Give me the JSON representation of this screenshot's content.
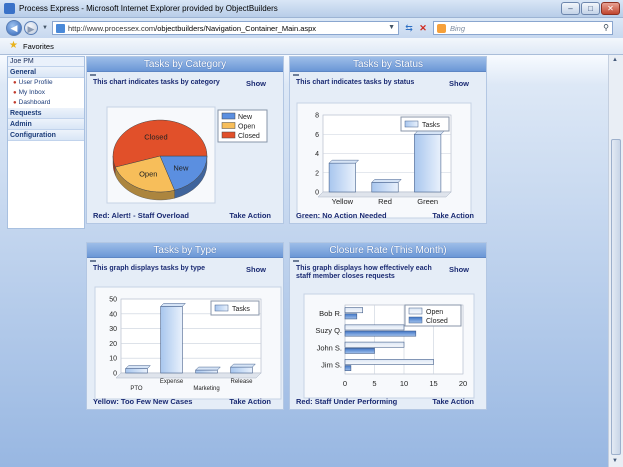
{
  "window": {
    "title": "Process Express - Microsoft Internet Explorer provided by ObjectBuilders"
  },
  "address": {
    "url_host": "http://www.processex.com",
    "url_path": "/objectbuilders/Navigation_Container_Main.aspx",
    "search_placeholder": "Bing"
  },
  "favorites": {
    "label": "Favorites"
  },
  "sidebar": {
    "user": "Joe PM",
    "general": "General",
    "items": [
      "User Profile",
      "My Inbox",
      "Dashboard"
    ],
    "requests": "Requests",
    "admin": "Admin",
    "configuration": "Configuration"
  },
  "panels": {
    "category": {
      "title": "Tasks by Category",
      "desc": "This chart indicates tasks by category",
      "show": "Show",
      "status": "Red: Alert! - Staff Overload",
      "action": "Take Action"
    },
    "status": {
      "title": "Tasks by Status",
      "desc": "This chart indicates tasks by status",
      "show": "Show",
      "status": "Green: No Action Needed",
      "action": "Take Action"
    },
    "type": {
      "title": "Tasks by Type",
      "desc": "This graph displays tasks by type",
      "show": "Show",
      "status": "Yellow: Too Few New Cases",
      "action": "Take Action"
    },
    "closure": {
      "title": "Closure Rate (This Month)",
      "desc": "This graph displays how effectively each staff member closes requests",
      "show": "Show",
      "status": "Red: Staff Under Performing",
      "action": "Take Action"
    }
  },
  "chart_data": [
    {
      "type": "pie",
      "labels": [
        "New",
        "Open",
        "Closed"
      ],
      "values": [
        20,
        25,
        55
      ],
      "colors": [
        "#5b8fe0",
        "#f7be5a",
        "#e1502a"
      ],
      "legend": "top-right"
    },
    {
      "type": "bar",
      "categories": [
        "Yellow",
        "Red",
        "Green"
      ],
      "series": [
        {
          "name": "Tasks",
          "values": [
            3,
            1,
            6
          ]
        }
      ],
      "ylim": [
        0,
        8
      ],
      "yticks": [
        0,
        2,
        4,
        6,
        8
      ],
      "legend": "top-right"
    },
    {
      "type": "bar",
      "categories": [
        "PTO",
        "Expense",
        "Marketing",
        "Release"
      ],
      "series": [
        {
          "name": "Tasks",
          "values": [
            3,
            45,
            2,
            4
          ]
        }
      ],
      "ylim": [
        0,
        50
      ],
      "yticks": [
        0,
        10,
        20,
        30,
        40,
        50
      ],
      "legend": "top-right"
    },
    {
      "type": "bar",
      "orientation": "horizontal",
      "categories": [
        "Bob R.",
        "Suzy Q.",
        "John S.",
        "Jim S."
      ],
      "series": [
        {
          "name": "Open",
          "values": [
            3,
            10,
            10,
            15
          ]
        },
        {
          "name": "Closed",
          "values": [
            2,
            12,
            5,
            1
          ]
        }
      ],
      "xlim": [
        0,
        20
      ],
      "xticks": [
        0,
        5,
        10,
        15,
        20
      ],
      "legend": "top-right"
    }
  ]
}
